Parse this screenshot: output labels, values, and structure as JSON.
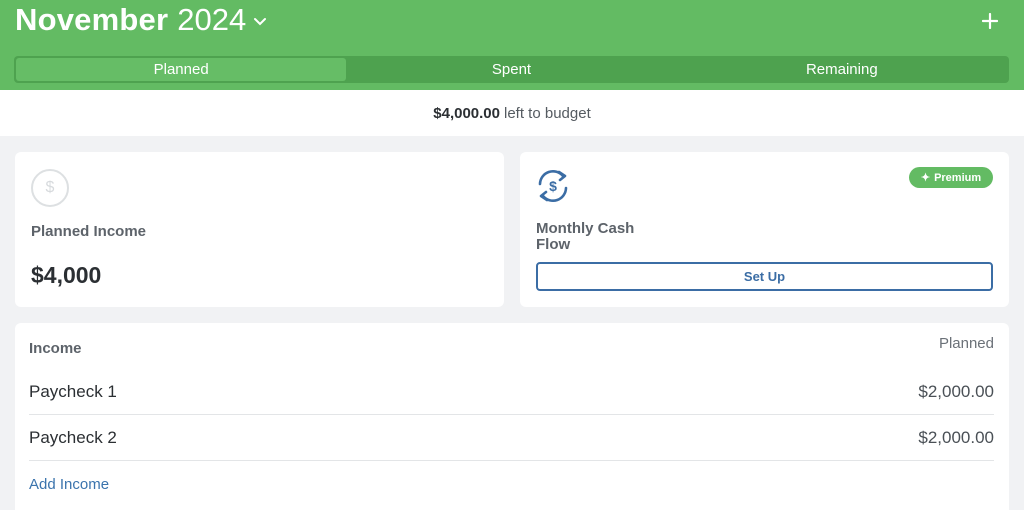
{
  "header": {
    "month": "November",
    "year": "2024",
    "tabs": [
      {
        "label": "Planned",
        "active": true
      },
      {
        "label": "Spent",
        "active": false
      },
      {
        "label": "Remaining",
        "active": false
      }
    ]
  },
  "left_to_budget": {
    "amount": "$4,000.00",
    "text": "left to budget"
  },
  "planned_income_card": {
    "icon_glyph": "$",
    "label": "Planned Income",
    "value": "$4,000"
  },
  "cash_flow_card": {
    "badge": "Premium",
    "label": "Monthly Cash Flow",
    "button": "Set Up"
  },
  "income_table": {
    "heading": "Income",
    "column": "Planned",
    "rows": [
      {
        "name": "Paycheck 1",
        "amount": "$2,000.00"
      },
      {
        "name": "Paycheck 2",
        "amount": "$2,000.00"
      }
    ],
    "add_label": "Add Income"
  },
  "colors": {
    "brand_green": "#63bb63",
    "dark_green": "#4ea24f",
    "accent_blue": "#3b6da5"
  },
  "icons": [
    "chevron-down-icon",
    "plus-icon",
    "dollar-coin-icon",
    "cash-flow-refresh-icon",
    "sparkle-icon"
  ]
}
